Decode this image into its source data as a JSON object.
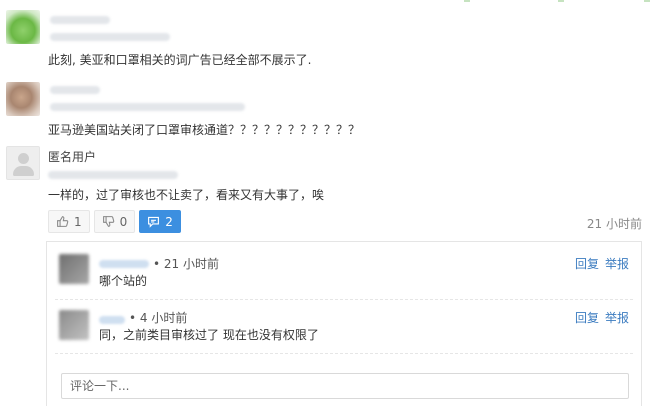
{
  "comments": [
    {
      "text": "此刻, 美亚和口罩相关的词广告已经全部不展示了."
    },
    {
      "text": "亚马逊美国站关闭了口罩审核通道？？？？？？？？？？？"
    },
    {
      "username": "匿名用户",
      "text": "一样的，过了审核也不让卖了，看来又有大事了，唉"
    }
  ],
  "actions": {
    "like_count": "1",
    "dislike_count": "0",
    "reply_count": "2",
    "time": "21 小时前"
  },
  "replies": [
    {
      "time": "• 21 小时前",
      "text": "哪个站的",
      "reply_label": "回复",
      "report_label": "举报"
    },
    {
      "time": "• 4 小时前",
      "text": "同，之前类目审核过了 现在也没有权限了",
      "reply_label": "回复",
      "report_label": "举报"
    }
  ],
  "comment_input": {
    "placeholder": "评论一下..."
  },
  "colors": {
    "accent": "#3c8fe0",
    "link": "#3c7cc0"
  }
}
